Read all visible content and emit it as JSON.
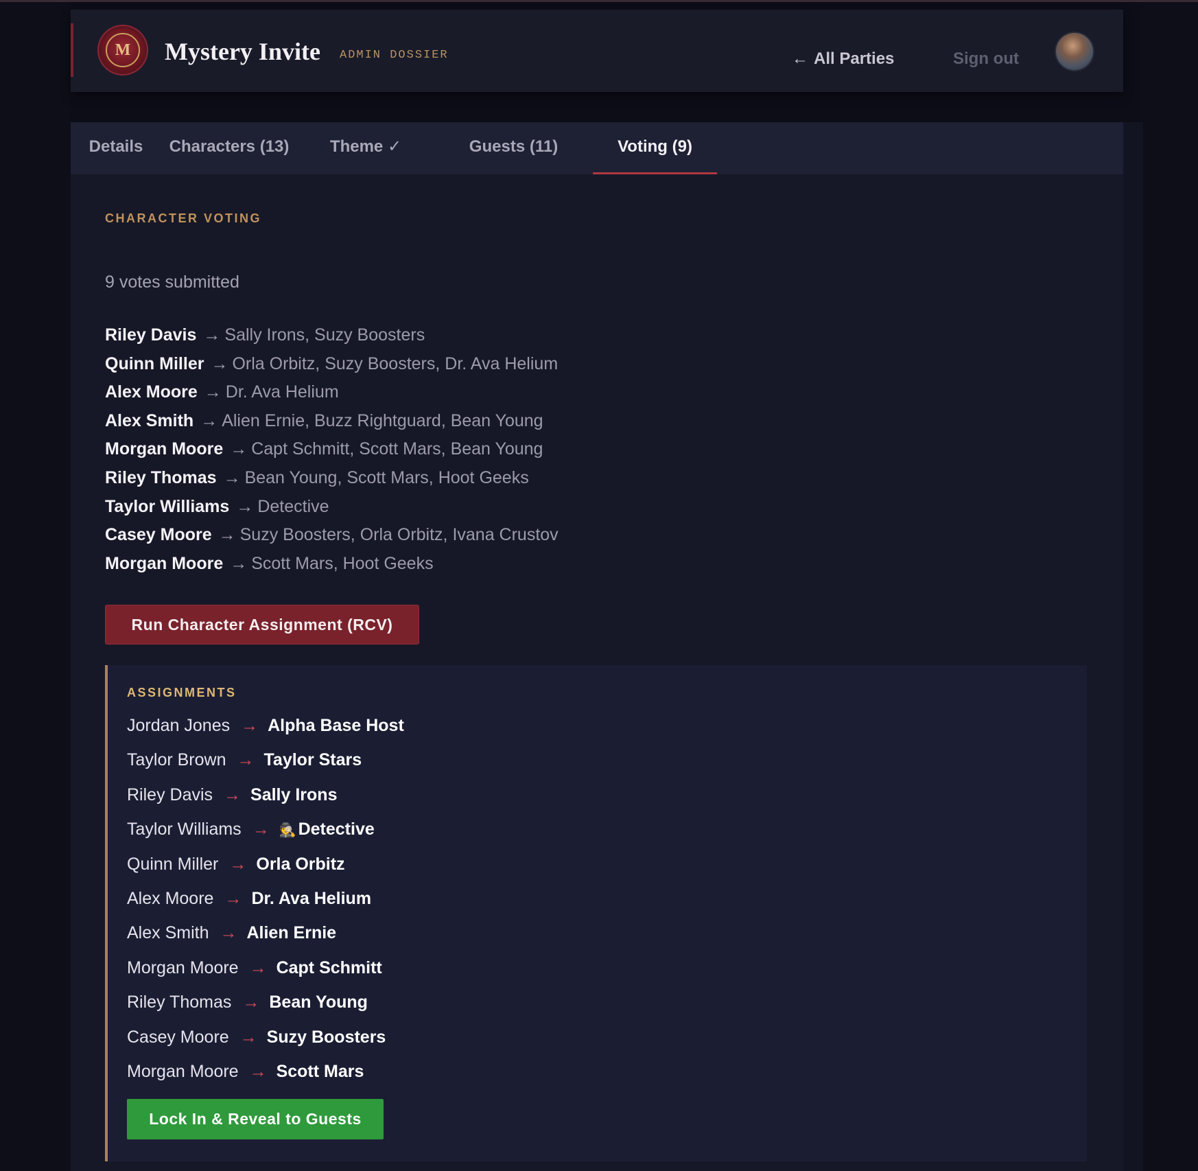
{
  "header": {
    "logo_text": "M",
    "brand": "Mystery Invite",
    "tag": "ADMIN DOSSIER",
    "back_arrow": "←",
    "back_label": "All Parties",
    "signout_label": "Sign out"
  },
  "tabs": [
    {
      "label": "Details",
      "active": false
    },
    {
      "label": "Characters (13)",
      "active": false
    },
    {
      "label": "Theme ✓",
      "active": false
    },
    {
      "label": "Guests (11)",
      "active": false
    },
    {
      "label": "Voting (9)",
      "active": true
    }
  ],
  "voting": {
    "title": "CHARACTER VOTING",
    "count_text": "9 votes submitted",
    "arrow": "→",
    "votes": [
      {
        "voter": "Riley Davis",
        "choices": "Sally Irons, Suzy Boosters"
      },
      {
        "voter": "Quinn Miller",
        "choices": "Orla Orbitz, Suzy Boosters, Dr. Ava Helium"
      },
      {
        "voter": "Alex Moore",
        "choices": "Dr. Ava Helium"
      },
      {
        "voter": "Alex Smith",
        "choices": "Alien Ernie, Buzz Rightguard, Bean Young"
      },
      {
        "voter": "Morgan Moore",
        "choices": "Capt Schmitt, Scott Mars, Bean Young"
      },
      {
        "voter": "Riley Thomas",
        "choices": "Bean Young, Scott Mars, Hoot Geeks"
      },
      {
        "voter": "Taylor Williams",
        "choices": "Detective"
      },
      {
        "voter": "Casey Moore",
        "choices": "Suzy Boosters, Orla Orbitz, Ivana Crustov"
      },
      {
        "voter": "Morgan Moore",
        "choices": "Scott Mars, Hoot Geeks"
      }
    ],
    "run_button": "Run Character Assignment (RCV)"
  },
  "assignments": {
    "title": "ASSIGNMENTS",
    "arrow": "→",
    "rows": [
      {
        "guest": "Jordan Jones",
        "character": "Alpha Base Host",
        "emoji": ""
      },
      {
        "guest": "Taylor Brown",
        "character": "Taylor Stars",
        "emoji": ""
      },
      {
        "guest": "Riley Davis",
        "character": "Sally Irons",
        "emoji": ""
      },
      {
        "guest": "Taylor Williams",
        "character": "Detective",
        "emoji": "🕵"
      },
      {
        "guest": "Quinn Miller",
        "character": "Orla Orbitz",
        "emoji": ""
      },
      {
        "guest": "Alex Moore",
        "character": "Dr. Ava Helium",
        "emoji": ""
      },
      {
        "guest": "Alex Smith",
        "character": "Alien Ernie",
        "emoji": ""
      },
      {
        "guest": "Morgan Moore",
        "character": "Capt Schmitt",
        "emoji": ""
      },
      {
        "guest": "Riley Thomas",
        "character": "Bean Young",
        "emoji": ""
      },
      {
        "guest": "Casey Moore",
        "character": "Suzy Boosters",
        "emoji": ""
      },
      {
        "guest": "Morgan Moore",
        "character": "Scott Mars",
        "emoji": ""
      }
    ],
    "lock_button": "Lock In & Reveal to Guests"
  },
  "colors": {
    "accent_red": "#7a222c",
    "accent_gold": "#c0935c",
    "success_green": "#2f9a3c",
    "background": "#171827"
  },
  "icons": {
    "logo": "monogram-seal-icon",
    "back": "arrow-left-icon",
    "avatar": "user-avatar"
  }
}
